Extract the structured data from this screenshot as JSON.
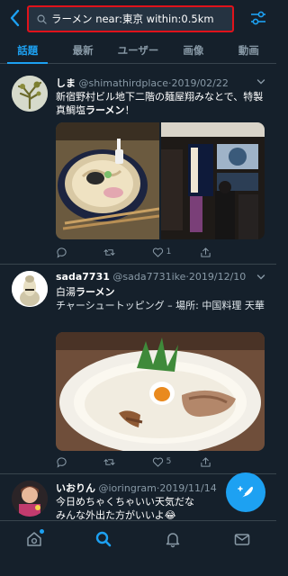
{
  "search": {
    "query": "ラーメン near:東京 within:0.5km"
  },
  "tabs": [
    {
      "label": "話題"
    },
    {
      "label": "最新"
    },
    {
      "label": "ユーザー"
    },
    {
      "label": "画像"
    },
    {
      "label": "動画"
    }
  ],
  "tweets": [
    {
      "name": "しま",
      "handle": "@shimathirdplace",
      "date": "2019/02/22",
      "text_before": "新宿野村ビル地下二階の麺屋翔みなとで、特製真鯛塩",
      "highlight": "ラーメン",
      "text_after": "！",
      "reply_count": "",
      "retweet_count": "",
      "like_count": "1"
    },
    {
      "name": "sada7731",
      "handle": "@sada7731ike",
      "date": "2019/12/10",
      "text_before": "白湯",
      "highlight": "ラーメン",
      "text_after": "",
      "line2": "チャーシュートッピング – 場所: 中国料理 天華",
      "reply_count": "",
      "retweet_count": "",
      "like_count": "5"
    },
    {
      "name": "いおりん",
      "handle": "@ioringram",
      "date": "2019/11/14",
      "text_before": "今日めちゃくちゃいい天気だな",
      "line2": "みんな外出た方がいいよ😂"
    }
  ],
  "icons": {
    "back": "chevron-left-icon",
    "filter": "sliders-icon",
    "compose": "feather-icon",
    "nav": [
      "home-icon",
      "search-icon",
      "bell-icon",
      "mail-icon"
    ]
  },
  "colors": {
    "background": "#15202b",
    "accent": "#1da1f2",
    "search_highlight_border": "#e0121b",
    "secondary_text": "#8899a6"
  }
}
